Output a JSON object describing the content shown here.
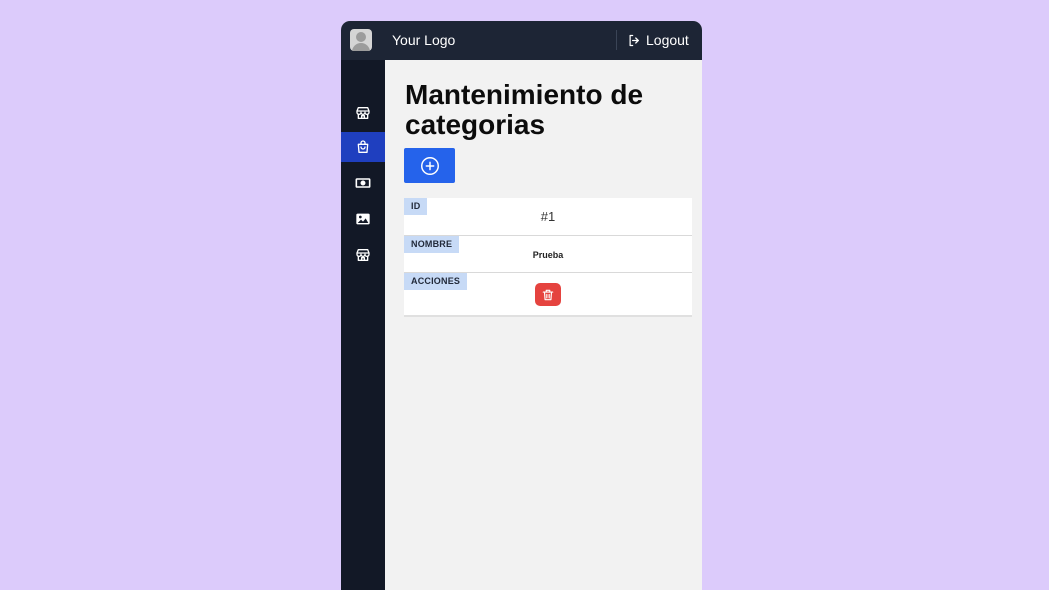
{
  "header": {
    "logo_text": "Your Logo",
    "logout_label": "Logout"
  },
  "sidebar": {
    "items": [
      {
        "icon": "store-icon",
        "active": false
      },
      {
        "icon": "shopping-bag-icon",
        "active": true
      },
      {
        "icon": "cash-icon",
        "active": false
      },
      {
        "icon": "image-icon",
        "active": false
      },
      {
        "icon": "store-icon",
        "active": false
      }
    ]
  },
  "main": {
    "title": "Mantenimiento de categorias",
    "add_button_icon": "plus-circle-icon",
    "record": {
      "id_label": "ID",
      "id_value": "#1",
      "name_label": "NOMBRE",
      "name_value": "Prueba",
      "actions_label": "ACCIONES",
      "delete_icon": "trash-icon"
    }
  },
  "colors": {
    "background": "#dccbfb",
    "topbar": "#1d2535",
    "sidebar": "#121826",
    "sidebar_active": "#1f3fbf",
    "primary": "#2563eb",
    "danger": "#e5433f",
    "label_bg": "#c7daf6"
  }
}
